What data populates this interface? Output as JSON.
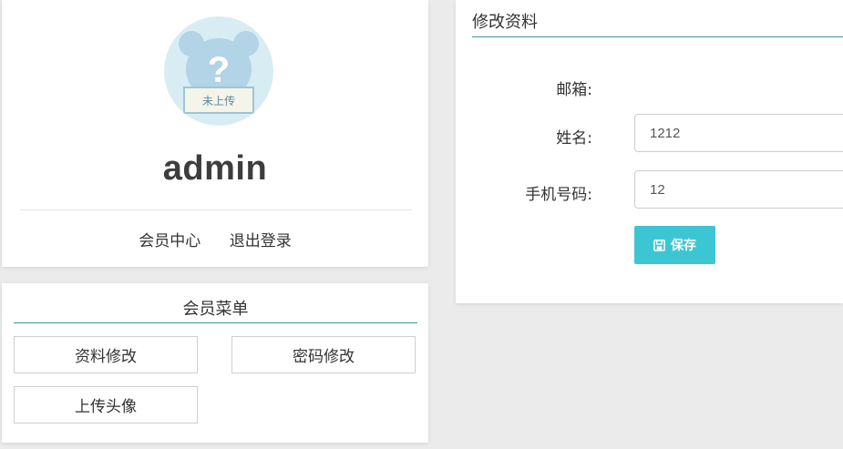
{
  "profile": {
    "username": "admin",
    "links": [
      "会员中心",
      "退出登录"
    ],
    "avatar_icon": "placeholder-bear-avatar-icon",
    "avatar_text": "?",
    "avatar_sign": "未上传"
  },
  "menu": {
    "title": "会员菜单",
    "items": [
      "资料修改",
      "密码修改",
      "上传头像"
    ]
  },
  "edit": {
    "title": "修改资料",
    "labels": {
      "email": "邮箱:",
      "name": "姓名:",
      "phone": "手机号码:"
    },
    "values": {
      "name": "1212",
      "phone": "12"
    },
    "save_label": "保存",
    "save_icon": "floppy-disk-icon"
  },
  "colors": {
    "accent_line": "#3a9b93",
    "save_button": "#3cc6d3",
    "background": "#ebebeb"
  }
}
